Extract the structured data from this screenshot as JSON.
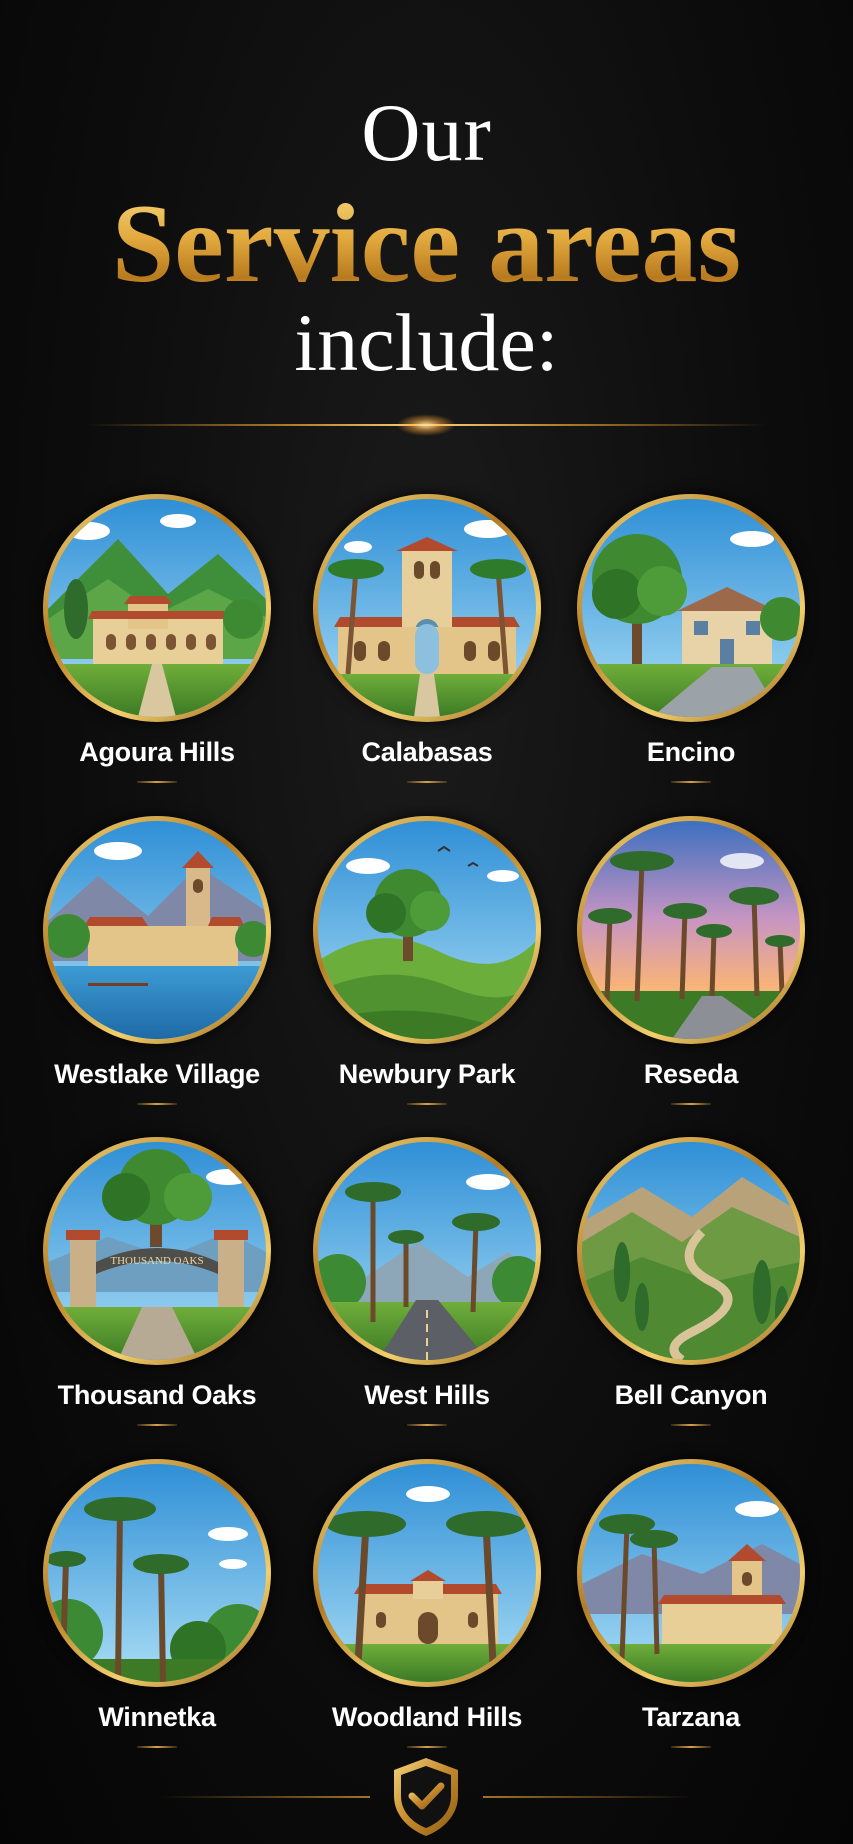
{
  "heading": {
    "line1": "Our",
    "line2": "Service areas",
    "line3": "include:"
  },
  "colors": {
    "background": "#0d0d0d",
    "gold": "#e2a93e",
    "text": "#ffffff"
  },
  "areas": [
    {
      "name": "Agoura Hills",
      "scene": "mission-valley-mountains"
    },
    {
      "name": "Calabasas",
      "scene": "mission-tower-palms"
    },
    {
      "name": "Encino",
      "scene": "oak-house-street"
    },
    {
      "name": "Westlake Village",
      "scene": "lake-bell-tower"
    },
    {
      "name": "Newbury Park",
      "scene": "oak-on-green-hills"
    },
    {
      "name": "Reseda",
      "scene": "palm-lined-street-sunset"
    },
    {
      "name": "Thousand Oaks",
      "scene": "stone-gate-sign",
      "sign_text": "THOUSAND OAKS"
    },
    {
      "name": "West Hills",
      "scene": "palm-road-mountains"
    },
    {
      "name": "Bell Canyon",
      "scene": "winding-canyon-road"
    },
    {
      "name": "Winnetka",
      "scene": "tall-palms-sky"
    },
    {
      "name": "Woodland Hills",
      "scene": "palms-mission-building"
    },
    {
      "name": "Tarzana",
      "scene": "palms-tower-villa"
    }
  ],
  "footer": {
    "icon": "shield-check-icon"
  }
}
